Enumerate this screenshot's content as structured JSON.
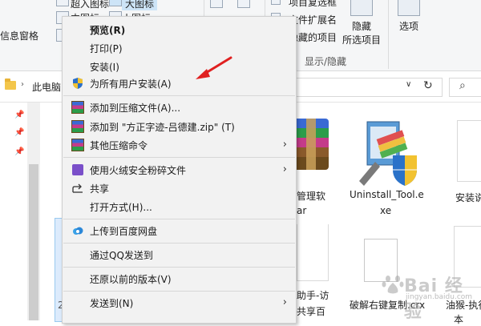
{
  "ribbon": {
    "top_item_1": "超入图标",
    "top_item_2": "大图标",
    "mid_item_1": "中图标",
    "mid_item_2": "小图标",
    "nav_pane": "信息窗格",
    "checkbox_1": "项目复选框",
    "checkbox_2": "文件扩展名",
    "checkbox_3": "隐藏的项目",
    "hide_button": "隐藏",
    "hide_sub": "所选项目",
    "options_button": "选项",
    "group_label": "显示/隐藏"
  },
  "address_bar": {
    "path": "此电脑",
    "chevron": "›",
    "dropdown": "∨",
    "refresh": "↻",
    "search_icon": "⌕"
  },
  "files": {
    "item_1": "管理软",
    "item_1_line2": "ar",
    "item_2": "Uninstall_Tool.e",
    "item_2_line2": "xe",
    "item_3": "安装说",
    "item_4": "助手-访",
    "item_4_line2": "共享百",
    "item_5": "破解右键复制.crx",
    "item_6": "油猴-执行",
    "item_6_line2": "本",
    "selected_stub": "2"
  },
  "context_menu": {
    "items": [
      {
        "label": "预览(R)",
        "icon": "none"
      },
      {
        "label": "打印(P)",
        "icon": "none"
      },
      {
        "label": "安装(I)",
        "icon": "none"
      },
      {
        "label": "为所有用户安装(A)",
        "icon": "uac-shield-icon"
      },
      {
        "label": "添加到压缩文件(A)...",
        "icon": "winrar-icon"
      },
      {
        "label": "添加到 \"方正字迹-吕德建.zip\" (T)",
        "icon": "winrar-icon"
      },
      {
        "label": "其他压缩命令",
        "icon": "winrar-icon"
      },
      {
        "label": "使用火绒安全粉碎文件",
        "icon": "huorong-icon"
      },
      {
        "label": "共享",
        "icon": "share-icon"
      },
      {
        "label": "打开方式(H)...",
        "icon": "none"
      },
      {
        "label": "上传到百度网盘",
        "icon": "baidu-cloud-icon"
      },
      {
        "label": "通过QQ发送到",
        "icon": "none"
      },
      {
        "label": "还原以前的版本(V)",
        "icon": "none"
      },
      {
        "label": "发送到(N)",
        "icon": "none"
      }
    ],
    "submenu_arrow": "›"
  },
  "watermark": {
    "text": "Bai 经验",
    "sub": "jingyan.baidu.com"
  },
  "colors": {
    "menu_bg": "#f2f2f2",
    "annotation": "#e02020",
    "ribbon_bg": "#f5f6f7"
  }
}
